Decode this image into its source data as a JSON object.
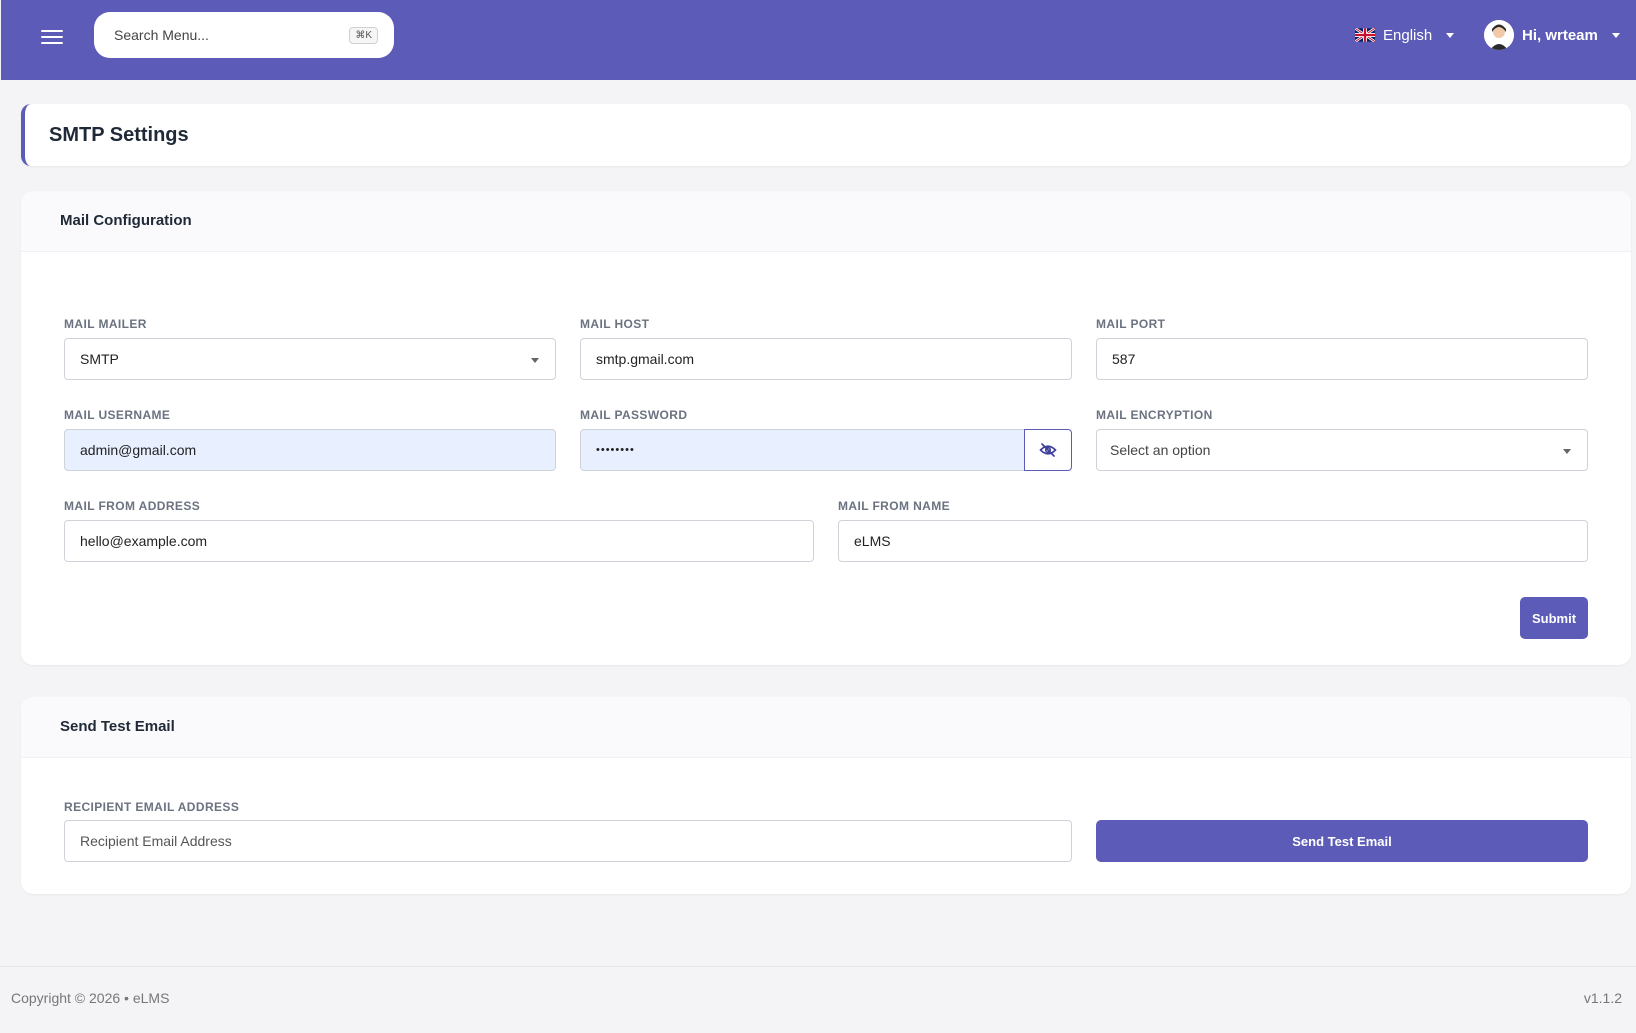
{
  "header": {
    "search_placeholder": "Search Menu...",
    "search_shortcut": "⌘K",
    "language": "English",
    "user_greeting": "Hi, wrteam"
  },
  "page": {
    "title": "SMTP Settings"
  },
  "mail_config": {
    "title": "Mail Configuration",
    "mailer": {
      "label": "MAIL MAILER",
      "value": "SMTP"
    },
    "host": {
      "label": "MAIL HOST",
      "value": "smtp.gmail.com"
    },
    "port": {
      "label": "MAIL PORT",
      "value": "587"
    },
    "username": {
      "label": "MAIL USERNAME",
      "value": "admin@gmail.com"
    },
    "password": {
      "label": "MAIL PASSWORD",
      "value": "••••••••"
    },
    "encryption": {
      "label": "MAIL ENCRYPTION",
      "value": "Select an option"
    },
    "from_address": {
      "label": "MAIL FROM ADDRESS",
      "value": "hello@example.com"
    },
    "from_name": {
      "label": "MAIL FROM NAME",
      "value": "eLMS"
    },
    "submit_label": "Submit"
  },
  "test_email": {
    "title": "Send Test Email",
    "recipient": {
      "label": "RECIPIENT EMAIL ADDRESS",
      "placeholder": "Recipient Email Address"
    },
    "send_label": "Send Test Email"
  },
  "footer": {
    "copyright": "Copyright © 2026 • eLMS",
    "version": "v1.1.2"
  },
  "colors": {
    "brand": "#5c5bb7",
    "autofill": "#e8efff"
  }
}
